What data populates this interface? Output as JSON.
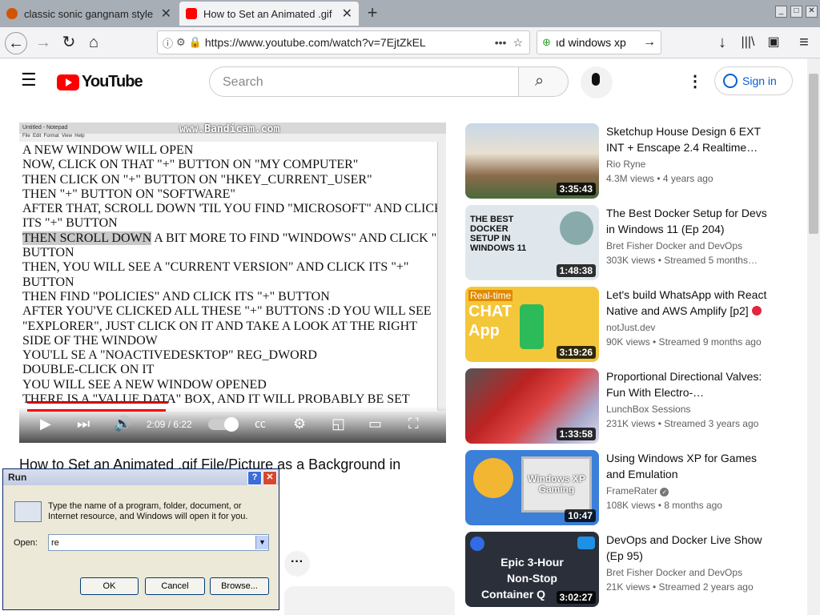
{
  "browser": {
    "tabs": [
      {
        "label": "classic sonic gangnam style"
      },
      {
        "label": "How to Set an Animated .gif"
      }
    ],
    "url": "https://www.youtube.com/watch?v=7EjtZkEL",
    "search_value": "ıd windows xp",
    "colors": {
      "accent_red": "#ff0000",
      "tab_active": "#f3f3f5"
    }
  },
  "youtube": {
    "logo": "YouTube",
    "search_placeholder": "Search",
    "sign_in": "Sign in"
  },
  "video": {
    "overlay_watermark": "www.Bandicam.com",
    "notepad_title": "Untitled - Notepad",
    "notepad_menu": "File  Edit  Format  View  Help",
    "lines": [
      "A NEW WINDOW WILL OPEN",
      "NOW, CLICK ON THAT \"+\" BUTTON ON \"MY COMPUTER\"",
      "THEN CLICK ON \"+\" BUTTON ON \"HKEY_CURRENT_USER\"",
      "THEN \"+\" BUTTON ON \"SOFTWARE\"",
      "AFTER THAT, SCROLL DOWN 'TIL YOU FIND \"MICROSOFT\" AND CLICK",
      "ITS \"+\" BUTTON",
      "THEN SCROLL DOWN A BIT MORE TO FIND \"WINDOWS\" AND CLICK \"+\"",
      "BUTTON",
      "THEN, YOU WILL SEE A \"CURRENT VERSION\" AND CLICK ITS \"+\"",
      "BUTTON",
      "THEN FIND \"POLICIES\" AND CLICK ITS \"+\" BUTTON",
      "AFTER YOU'VE CLICKED ALL THESE \"+\" BUTTONS :D YOU WILL SEE",
      "\"EXPLORER\", JUST CLICK ON IT AND TAKE A LOOK AT THE RIGHT",
      "SIDE OF THE WINDOW",
      "YOU'LL SE A \"NOACTIVEDESKTOP\" REG_DWORD",
      "DOUBLE-CLICK ON IT",
      "YOU WILL SEE A NEW WINDOW OPENED",
      "THERE IS A \"VALUE DATA\" BOX, AND IT WILL PROBABLY BE SET"
    ],
    "time": "2:09 / 6:22",
    "progress_fraction": 0.338,
    "title": "How to Set an Animated .gif File/Picture as a Background in"
  },
  "run_dialog": {
    "title": "Run",
    "description": "Type the name of a program, folder, document, or Internet resource, and Windows will open it for you.",
    "open_label": "Open:",
    "open_value": "re",
    "ok": "OK",
    "cancel": "Cancel",
    "browse": "Browse..."
  },
  "recommendations": [
    {
      "title": "Sketchup House Design 6 EXT INT + Enscape 2.4 Realtime…",
      "channel": "Rio Ryne",
      "meta": "4.3M views  •  4 years ago",
      "duration": "3:35:43"
    },
    {
      "title": "The Best Docker Setup for Devs in Windows 11 (Ep 204)",
      "channel": "Bret Fisher Docker and DevOps",
      "meta": "303K views  •  Streamed 5 months…",
      "duration": "1:48:38",
      "thumb_text": "THE BEST DOCKER SETUP IN WINDOWS 11"
    },
    {
      "title": "Let's build WhatsApp with React Native and AWS Amplify [p2]",
      "channel": "notJust.dev",
      "meta": "90K views  •  Streamed 9 months ago",
      "duration": "3:19:26",
      "thumb_text_1": "Real-time",
      "thumb_text_2": "CHAT",
      "thumb_text_3": "App"
    },
    {
      "title": "Proportional Directional Valves: Fun With Electro-…",
      "channel": "LunchBox Sessions",
      "meta": "231K views  •  Streamed 3 years ago",
      "duration": "1:33:58"
    },
    {
      "title": "Using Windows XP for Games and Emulation",
      "channel": "FrameRater",
      "meta": "108K views  •  8 months ago",
      "duration": "10:47",
      "thumb_text": "Windows XP Gaming"
    },
    {
      "title": "DevOps and Docker Live Show (Ep 95)",
      "channel": "Bret Fisher Docker and DevOps",
      "meta": "21K views  •  Streamed 2 years ago",
      "duration": "3:02:27",
      "thumb_text_1": "Epic 3-Hour",
      "thumb_text_2": "Non-Stop",
      "thumb_text_3": "Container Q"
    }
  ]
}
